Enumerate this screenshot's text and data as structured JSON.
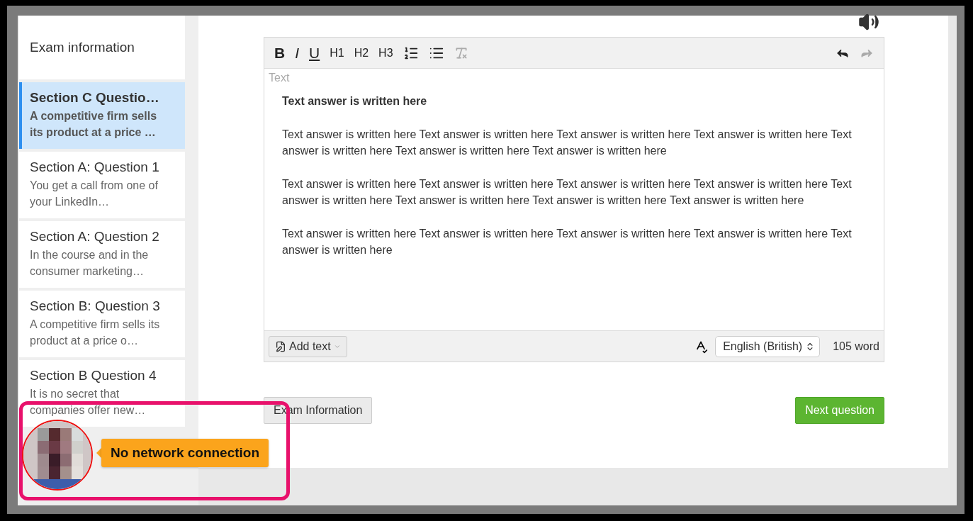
{
  "sidebar": {
    "header": "Exam information",
    "items": [
      {
        "title": "Section C Questio…",
        "excerpt": "A competitive firm sells its product at a price …",
        "selected": true
      },
      {
        "title": "Section A: Question 1",
        "excerpt": "You get a call from one of your LinkedIn…",
        "selected": false
      },
      {
        "title": "Section A: Question 2",
        "excerpt": "In the course and in the consumer marketing…",
        "selected": false
      },
      {
        "title": "Section B: Question 3",
        "excerpt": "A competitive firm sells its product at a price o…",
        "selected": false
      },
      {
        "title": "Section B Question 4",
        "excerpt": "It is no secret that companies offer new…",
        "selected": false
      }
    ]
  },
  "editor": {
    "toolbar": [
      {
        "kind": "bold",
        "label": "B"
      },
      {
        "kind": "italic",
        "label": "I"
      },
      {
        "kind": "underline",
        "label": "U"
      },
      {
        "kind": "heading",
        "label": "H1"
      },
      {
        "kind": "heading",
        "label": "H2"
      },
      {
        "kind": "heading",
        "label": "H3"
      },
      {
        "kind": "ordered-list"
      },
      {
        "kind": "bullet-list"
      },
      {
        "kind": "clear-format",
        "disabled": true
      }
    ],
    "history": [
      {
        "kind": "undo",
        "disabled": false
      },
      {
        "kind": "redo",
        "disabled": true
      }
    ],
    "placeholder": "Text",
    "paragraphs": [
      {
        "kind": "heading",
        "text": "Text answer is written here"
      },
      {
        "kind": "body",
        "text": "Text answer is written here Text answer is written here  Text answer is written here  Text answer is written here Text answer is written here Text answer is written here Text answer is written here"
      },
      {
        "kind": "body",
        "text": "Text answer is written here Text answer is written here Text answer is written here  Text answer is written here Text answer is written here Text answer is written here Text answer is written here Text answer is written here"
      },
      {
        "kind": "body",
        "text": "Text answer is written here Text answer is written here Text answer is written here Text answer is written here Text answer is written here"
      }
    ],
    "add_text": "Add text",
    "language": "English (British)",
    "word_count": "105 word"
  },
  "buttons": {
    "exam_information": "Exam Information",
    "next_question": "Next question"
  },
  "status": {
    "message": "No network connection"
  }
}
